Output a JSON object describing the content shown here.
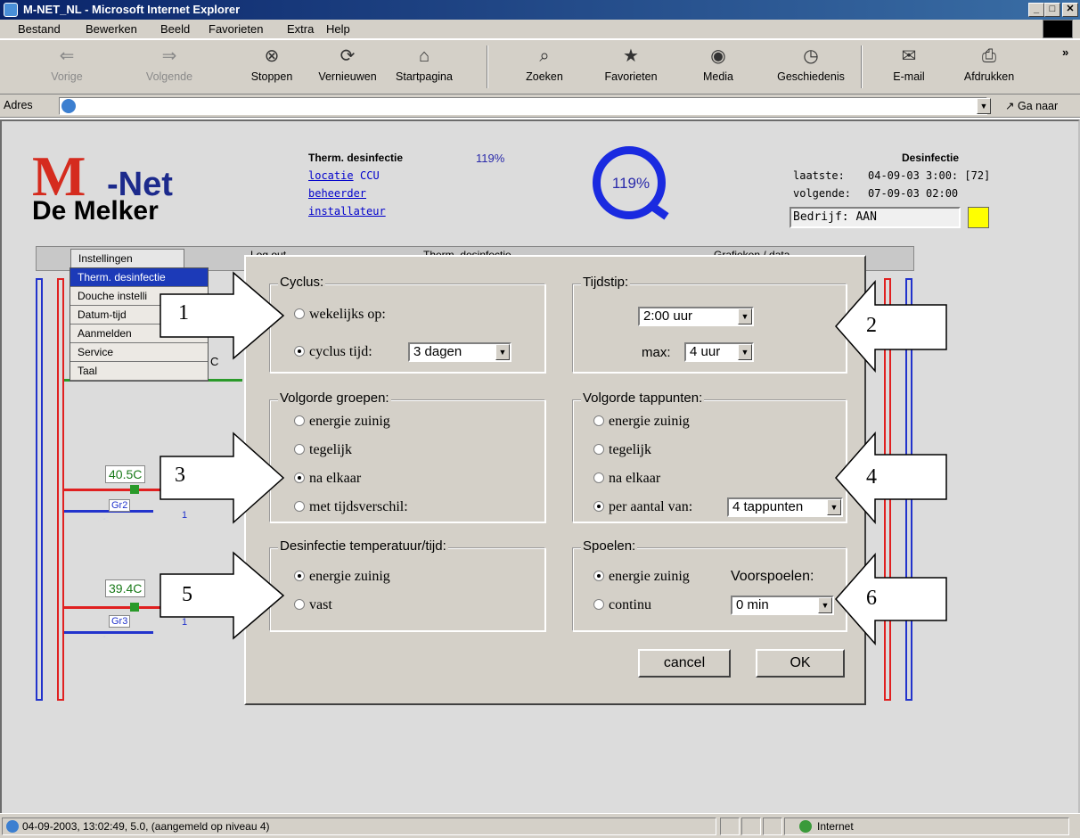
{
  "window": {
    "title": "M-NET_NL - Microsoft Internet Explorer"
  },
  "menu": [
    "Bestand",
    "Bewerken",
    "Beeld",
    "Favorieten",
    "Extra",
    "Help"
  ],
  "toolbar": {
    "back": "Vorige",
    "forward": "Volgende",
    "stop": "Stoppen",
    "refresh": "Vernieuwen",
    "home": "Startpagina",
    "search": "Zoeken",
    "favorites": "Favorieten",
    "media": "Media",
    "history": "Geschiedenis",
    "mail": "E-mail",
    "print": "Afdrukken"
  },
  "address": {
    "label": "Adres",
    "go": "Ga naar"
  },
  "header": {
    "logo_m": "M",
    "logo_net": "-Net",
    "logo_sub": "De Melker",
    "mode_title": "Therm. desinfectie",
    "mode_pct": "119%",
    "link_locatie": "locatie",
    "locatie_value": "CCU",
    "link_beheerder": "beheerder",
    "link_installateur": "installateur",
    "gauge": "119%",
    "right_title": "Desinfectie",
    "laatste_label": "laatste:",
    "laatste_value": "04-09-03 3:00: [72]",
    "volgende_label": "volgende:",
    "volgende_value": "07-09-03 02:00",
    "bedrijf": "Bedrijf: AAN",
    "indicator_color": "#ffff00"
  },
  "tabs": {
    "t1": "Instellingen",
    "t2": "Log out",
    "t3": "Therm. desinfectie",
    "t4": "Grafieken / data"
  },
  "dropdown": {
    "items": [
      "Therm. desinfectie",
      "Douche instelli",
      "Datum-tijd",
      "Aanmelden",
      "Service",
      "Taal"
    ]
  },
  "scheme": {
    "temp1": "40.5C",
    "temp2": "39.4C",
    "gr2": "Gr2",
    "gr3": "Gr3",
    "one": "1",
    "c": "C"
  },
  "dialog": {
    "cyclus": {
      "title": "Cyclus:",
      "opt1": "wekelijks op:",
      "opt2": "cyclus tijd:",
      "select": "3 dagen"
    },
    "tijdstip": {
      "title": "Tijdstip:",
      "time": "2:00 uur",
      "max_label": "max:",
      "max": "4 uur"
    },
    "groepen": {
      "title": "Volgorde groepen:",
      "opt1": "energie zuinig",
      "opt2": "tegelijk",
      "opt3": "na elkaar",
      "opt4": "met tijdsverschil:"
    },
    "tappunten": {
      "title": "Volgorde tappunten:",
      "opt1": "energie zuinig",
      "opt2": "tegelijk",
      "opt3": "na elkaar",
      "opt4": "per aantal van:",
      "select": "4 tappunten"
    },
    "temp": {
      "title": "Desinfectie temperatuur/tijd:",
      "opt1": "energie zuinig",
      "opt2": "vast"
    },
    "spoelen": {
      "title": "Spoelen:",
      "opt1": "energie zuinig",
      "opt2": "continu",
      "voor_label": "Voorspoelen:",
      "voor": "0 min"
    },
    "cancel": "cancel",
    "ok": "OK"
  },
  "callouts": [
    "1",
    "2",
    "3",
    "4",
    "5",
    "6"
  ],
  "status": {
    "text": "04-09-2003, 13:02:49, 5.0, (aangemeld op niveau 4)",
    "zone": "Internet"
  }
}
